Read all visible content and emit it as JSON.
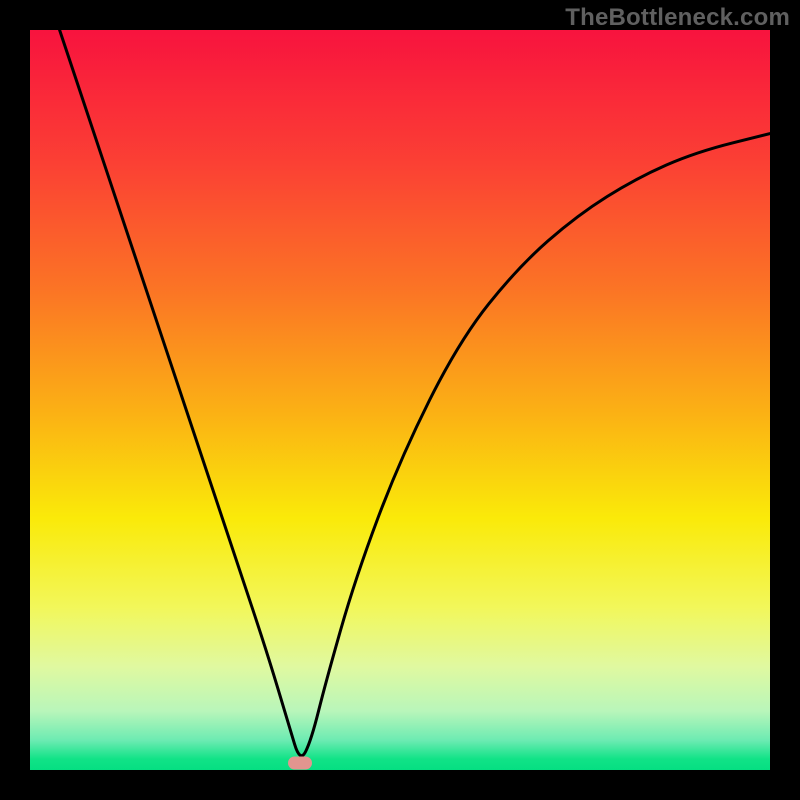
{
  "watermark": "TheBottleneck.com",
  "chart_data": {
    "type": "line",
    "title": "",
    "xlabel": "",
    "ylabel": "",
    "xlim": [
      0,
      100
    ],
    "ylim": [
      0,
      100
    ],
    "grid": false,
    "legend": false,
    "series": [
      {
        "name": "curve",
        "x": [
          4,
          8,
          12,
          16,
          20,
          24,
          28,
          32,
          35,
          36.5,
          38,
          40,
          44,
          50,
          58,
          66,
          74,
          82,
          90,
          100
        ],
        "values": [
          100,
          88,
          76,
          64,
          52,
          40,
          28,
          16,
          6,
          1,
          4,
          12,
          26,
          42,
          58,
          68,
          75,
          80,
          83.5,
          86
        ]
      }
    ],
    "marker": {
      "x": 36.5,
      "y": 1
    },
    "gradient_stops": [
      {
        "pos": 0.0,
        "color": "#f8133e"
      },
      {
        "pos": 0.18,
        "color": "#fb4034"
      },
      {
        "pos": 0.35,
        "color": "#fb7425"
      },
      {
        "pos": 0.52,
        "color": "#fbb214"
      },
      {
        "pos": 0.66,
        "color": "#faea09"
      },
      {
        "pos": 0.78,
        "color": "#f2f75a"
      },
      {
        "pos": 0.86,
        "color": "#e0f9a0"
      },
      {
        "pos": 0.92,
        "color": "#b9f6ba"
      },
      {
        "pos": 0.96,
        "color": "#6cebb2"
      },
      {
        "pos": 0.985,
        "color": "#11e387"
      },
      {
        "pos": 1.0,
        "color": "#05df82"
      }
    ]
  }
}
